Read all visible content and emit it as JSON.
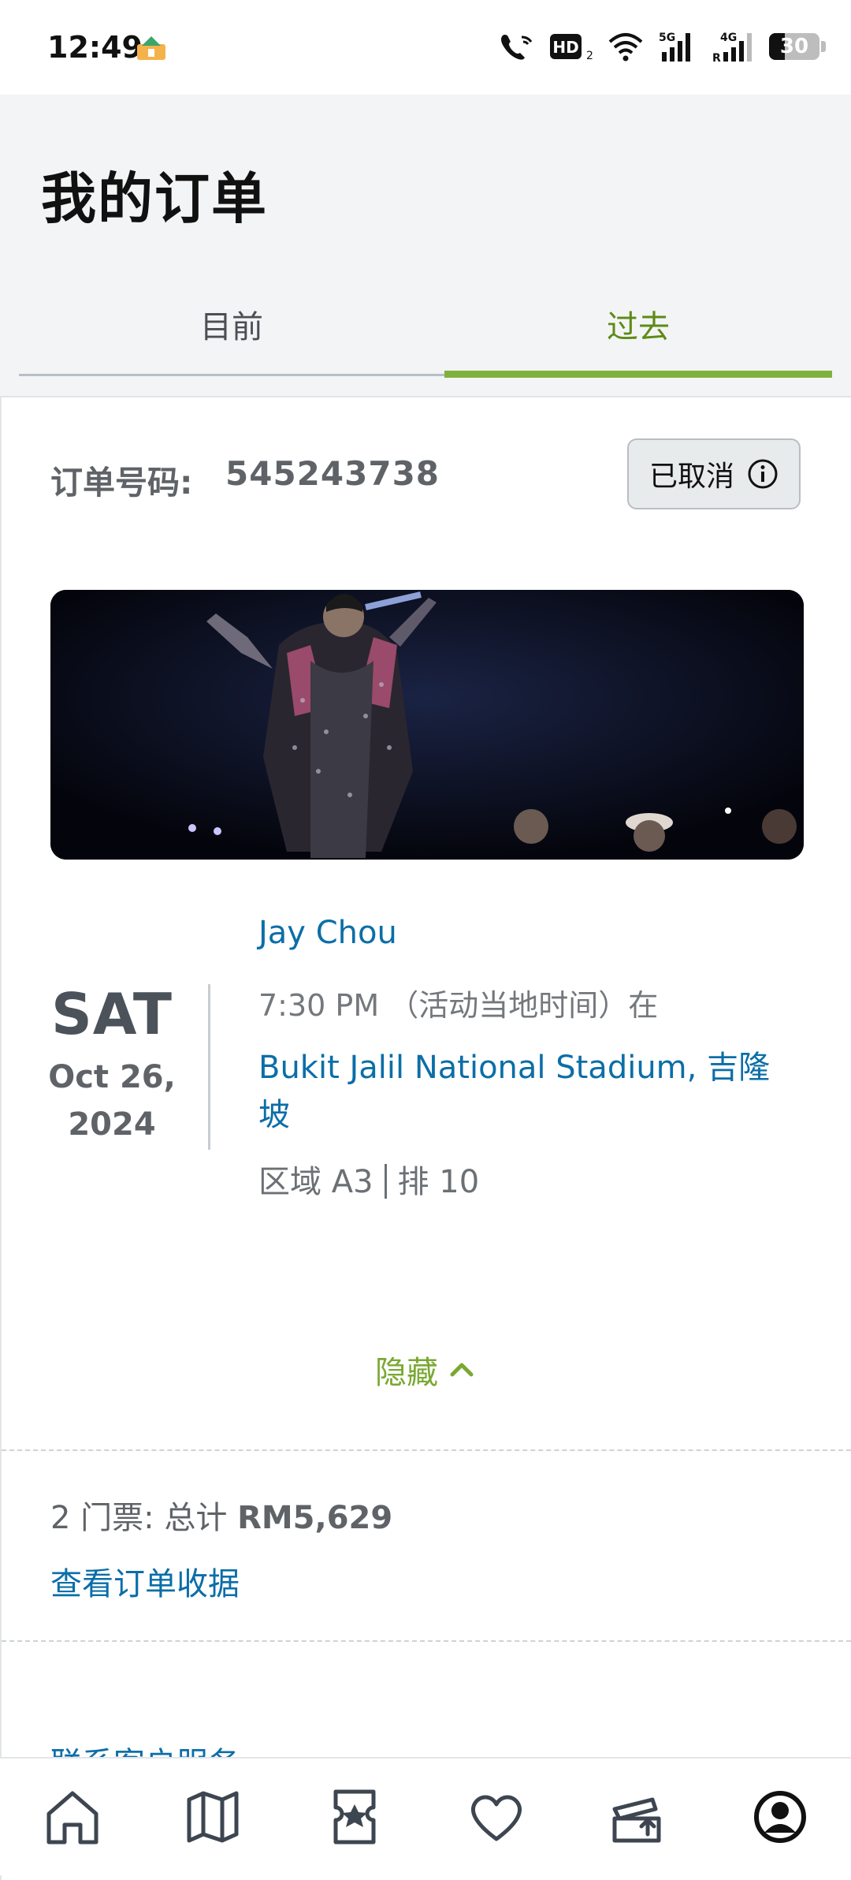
{
  "status_bar": {
    "time": "12:49",
    "battery": "30"
  },
  "header": {
    "title": "我的订单"
  },
  "tabs": [
    {
      "label": "目前"
    },
    {
      "label": "过去",
      "active": true
    }
  ],
  "order": {
    "number_label": "订单号码:",
    "number": "545243738",
    "status": "已取消",
    "date": {
      "weekday": "SAT",
      "month_day": "Oct 26,",
      "year": "2024"
    },
    "event_name": "Jay Chou",
    "time": "7:30 PM （活动当地时间）在",
    "venue": "Bukit Jalil National Stadium, 吉隆坡",
    "seat_section": "区域 A3",
    "seat_row": "排 10",
    "hide_label": "隐藏",
    "summary_prefix": "2 门票: 总计",
    "summary_total": "RM5,629",
    "receipt_link": "查看订单收据",
    "contact_link": "联系客户服务"
  },
  "bottom_nav": [
    {
      "icon": "home-icon"
    },
    {
      "icon": "map-icon"
    },
    {
      "icon": "ticket-star-icon"
    },
    {
      "icon": "heart-icon"
    },
    {
      "icon": "resale-ticket-icon"
    },
    {
      "icon": "account-icon",
      "active": true
    }
  ],
  "colors": {
    "accent_green": "#7fb13d",
    "link_blue": "#0b6ea8",
    "text_gray": "#5f6368"
  }
}
